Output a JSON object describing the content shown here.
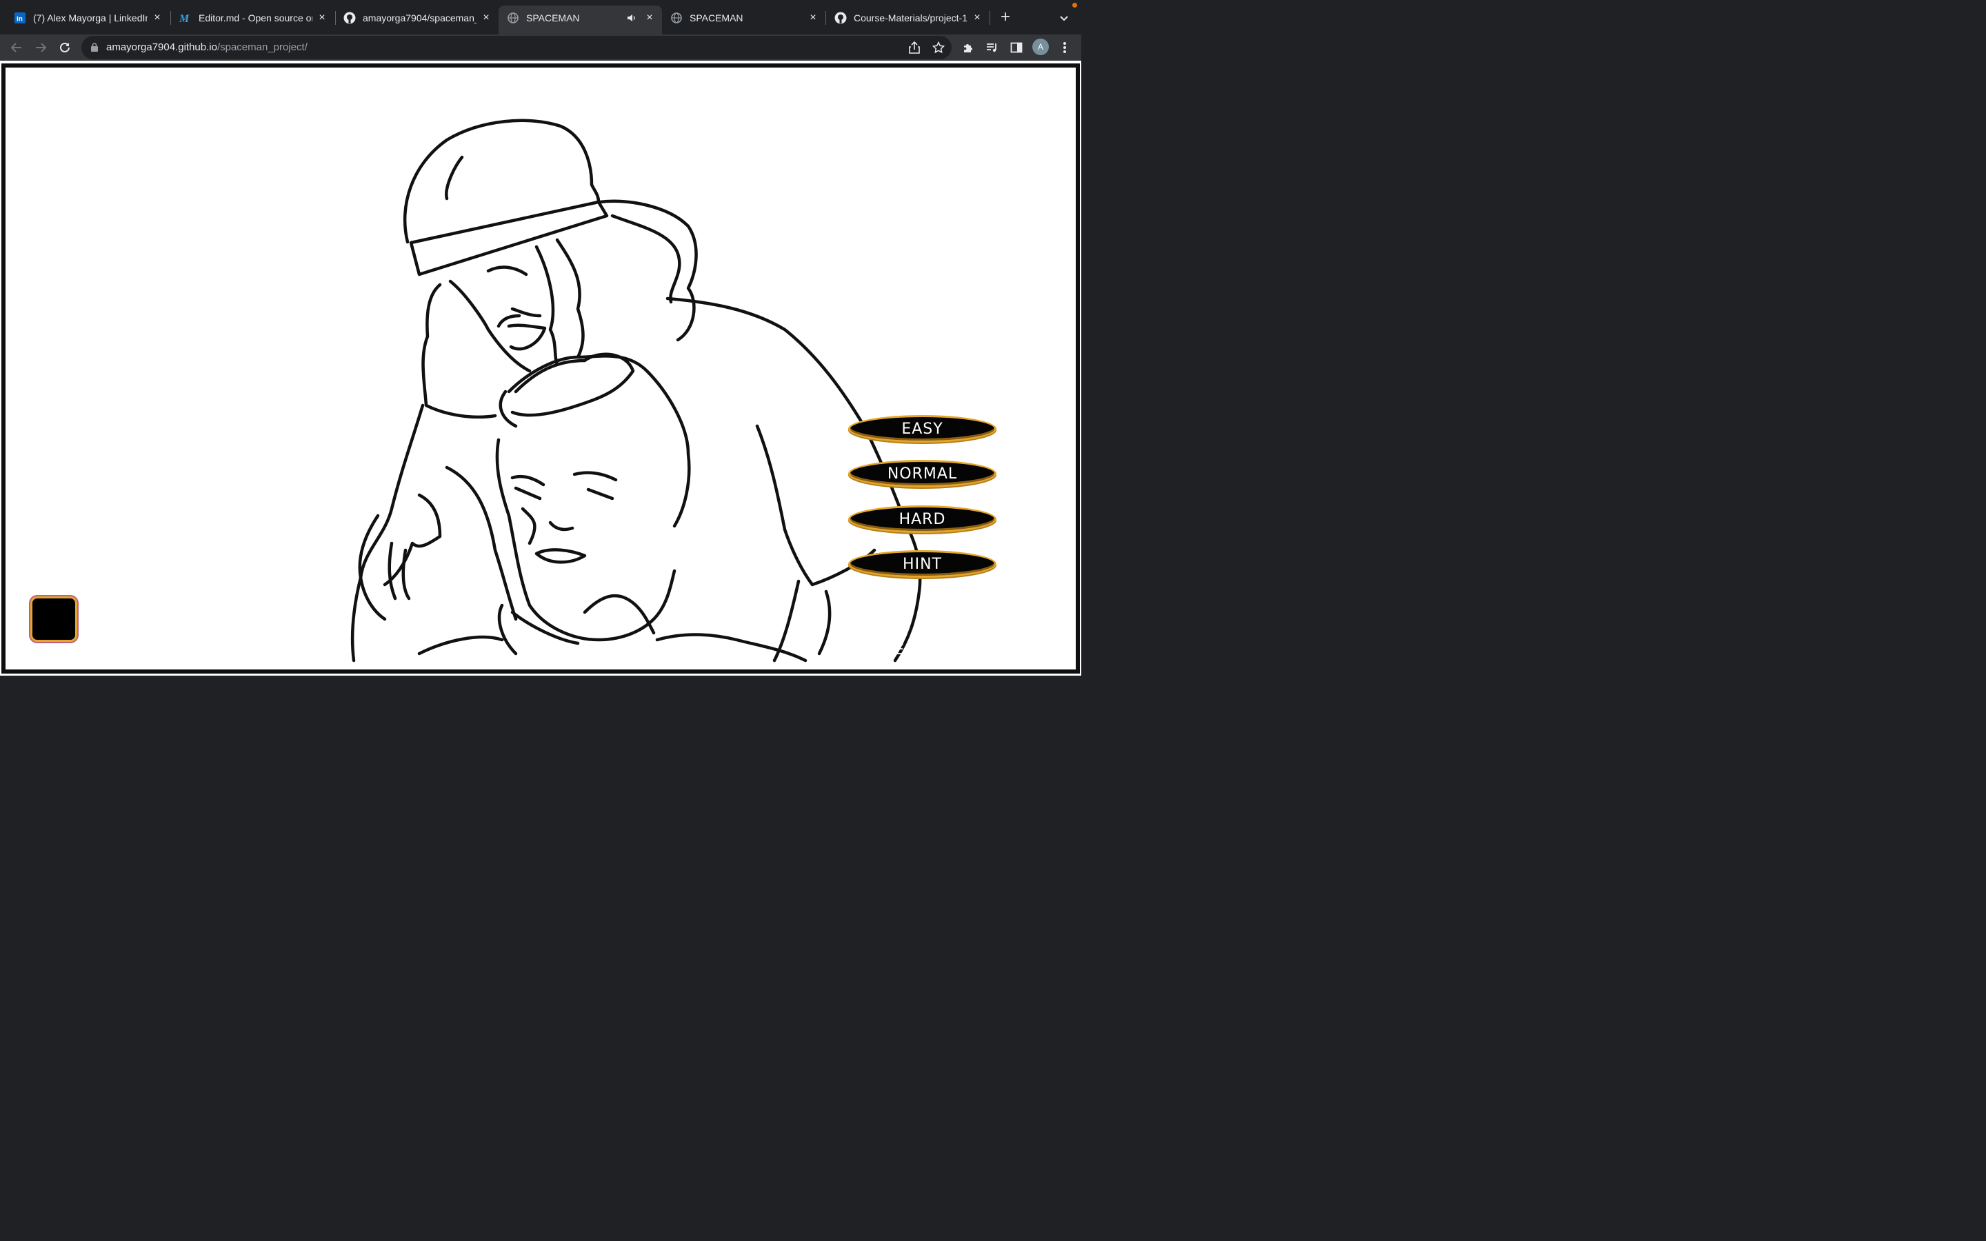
{
  "browser": {
    "tabs": [
      {
        "title": "(7) Alex Mayorga | LinkedIn",
        "icon": "linkedin-icon"
      },
      {
        "title": "Editor.md - Open source online",
        "icon": "editormd-icon"
      },
      {
        "title": "amayorga7904/spaceman_",
        "icon": "github-icon"
      },
      {
        "title": "SPACEMAN",
        "icon": "globe-icon",
        "active": true,
        "audio": true
      },
      {
        "title": "SPACEMAN",
        "icon": "globe-icon"
      },
      {
        "title": "Course-Materials/project-1",
        "icon": "github-icon"
      }
    ],
    "address": {
      "host": "amayorga7904.github.io",
      "path": "/spaceman_project/"
    },
    "avatar_initial": "A"
  },
  "game": {
    "buttons": {
      "easy": "EASY",
      "normal": "NORMAL",
      "hard": "HARD",
      "hint": "HINT"
    },
    "footer_text": "TE"
  },
  "colors": {
    "button_bg": "#050505",
    "button_border": "#e4a72b",
    "chrome_dark": "#202124",
    "chrome_toolbar": "#35363a"
  }
}
